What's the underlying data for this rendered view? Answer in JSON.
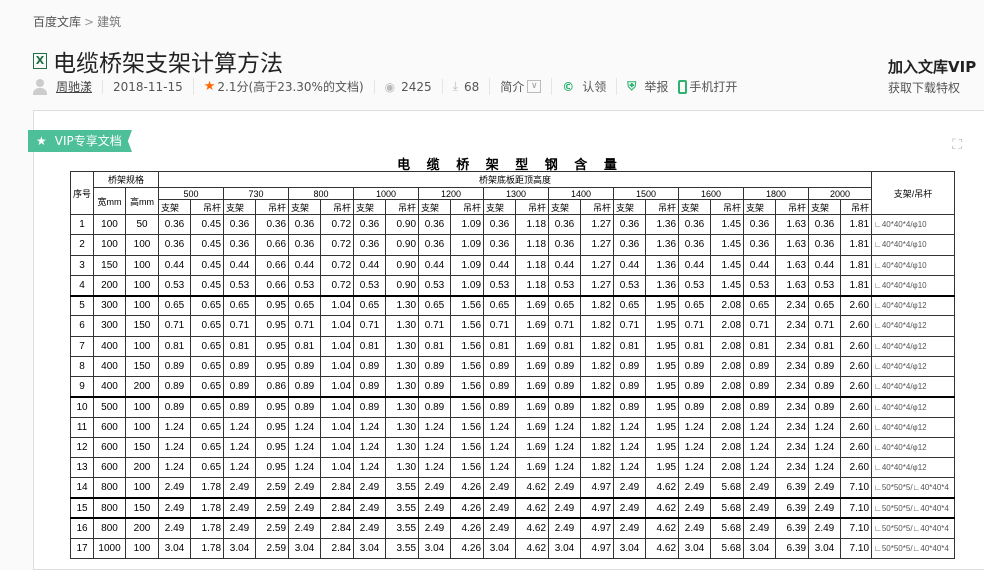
{
  "breadcrumb": {
    "home": "百度文库",
    "separator": ">",
    "current": "建筑"
  },
  "doc": {
    "title": "电缆桥架支架计算方法",
    "file_icon": "X"
  },
  "meta": {
    "author": "周驰漾",
    "date": "2018-11-15",
    "rating": "2.1分(高于23.30%的文档)",
    "views": "2425",
    "downloads": "68",
    "summary": "简介",
    "claim": "认领",
    "report": "举报",
    "mobile": "手机打开"
  },
  "vip": {
    "join": "加入文库VIP",
    "privilege": "获取下载特权",
    "badge": "VIP专享文档"
  },
  "colors": {
    "accent": "#4dbf99",
    "rating_star": "#ff6600",
    "icon_green": "#2db26f"
  },
  "table": {
    "title": "电 缆 桥 架 型 钢 含 量",
    "h_no": "序号",
    "h_spec": "桥架规格",
    "h_width": "宽mm",
    "h_height": "高mm",
    "h_distance": "桥架底板距顶高度",
    "h_last": "支架/吊杆",
    "sub": [
      "支架",
      "吊杆"
    ],
    "distances": [
      "500",
      "730",
      "800",
      "1000",
      "1200",
      "1300",
      "1400",
      "1500",
      "1600",
      "1800",
      "2000"
    ],
    "rows": [
      [
        "1",
        "100",
        "50",
        "0.36",
        "0.45",
        "0.36",
        "0.36",
        "0.36",
        "0.72",
        "0.36",
        "0.90",
        "0.36",
        "1.09",
        "0.36",
        "1.18",
        "0.36",
        "1.27",
        "0.36",
        "1.36",
        "0.36",
        "1.45",
        "0.36",
        "1.63",
        "0.36",
        "1.81",
        "∟40*40*4/φ10"
      ],
      [
        "2",
        "100",
        "100",
        "0.36",
        "0.45",
        "0.36",
        "0.66",
        "0.36",
        "0.72",
        "0.36",
        "0.90",
        "0.36",
        "1.09",
        "0.36",
        "1.18",
        "0.36",
        "1.27",
        "0.36",
        "1.36",
        "0.36",
        "1.45",
        "0.36",
        "1.63",
        "0.36",
        "1.81",
        "∟40*40*4/φ10"
      ],
      [
        "3",
        "150",
        "100",
        "0.44",
        "0.45",
        "0.44",
        "0.66",
        "0.44",
        "0.72",
        "0.44",
        "0.90",
        "0.44",
        "1.09",
        "0.44",
        "1.18",
        "0.44",
        "1.27",
        "0.44",
        "1.36",
        "0.44",
        "1.45",
        "0.44",
        "1.63",
        "0.44",
        "1.81",
        "∟40*40*4/φ10"
      ],
      [
        "4",
        "200",
        "100",
        "0.53",
        "0.45",
        "0.53",
        "0.66",
        "0.53",
        "0.72",
        "0.53",
        "0.90",
        "0.53",
        "1.09",
        "0.53",
        "1.18",
        "0.53",
        "1.27",
        "0.53",
        "1.36",
        "0.53",
        "1.45",
        "0.53",
        "1.63",
        "0.53",
        "1.81",
        "∟40*40*4/φ10"
      ],
      [
        "5",
        "300",
        "100",
        "0.65",
        "0.65",
        "0.65",
        "0.95",
        "0.65",
        "1.04",
        "0.65",
        "1.30",
        "0.65",
        "1.56",
        "0.65",
        "1.69",
        "0.65",
        "1.82",
        "0.65",
        "1.95",
        "0.65",
        "2.08",
        "0.65",
        "2.34",
        "0.65",
        "2.60",
        "∟40*40*4/φ12"
      ],
      [
        "6",
        "300",
        "150",
        "0.71",
        "0.65",
        "0.71",
        "0.95",
        "0.71",
        "1.04",
        "0.71",
        "1.30",
        "0.71",
        "1.56",
        "0.71",
        "1.69",
        "0.71",
        "1.82",
        "0.71",
        "1.95",
        "0.71",
        "2.08",
        "0.71",
        "2.34",
        "0.71",
        "2.60",
        "∟40*40*4/φ12"
      ],
      [
        "7",
        "400",
        "100",
        "0.81",
        "0.65",
        "0.81",
        "0.95",
        "0.81",
        "1.04",
        "0.81",
        "1.30",
        "0.81",
        "1.56",
        "0.81",
        "1.69",
        "0.81",
        "1.82",
        "0.81",
        "1.95",
        "0.81",
        "2.08",
        "0.81",
        "2.34",
        "0.81",
        "2.60",
        "∟40*40*4/φ12"
      ],
      [
        "8",
        "400",
        "150",
        "0.89",
        "0.65",
        "0.89",
        "0.95",
        "0.89",
        "1.04",
        "0.89",
        "1.30",
        "0.89",
        "1.56",
        "0.89",
        "1.69",
        "0.89",
        "1.82",
        "0.89",
        "1.95",
        "0.89",
        "2.08",
        "0.89",
        "2.34",
        "0.89",
        "2.60",
        "∟40*40*4/φ12"
      ],
      [
        "9",
        "400",
        "200",
        "0.89",
        "0.65",
        "0.89",
        "0.86",
        "0.89",
        "1.04",
        "0.89",
        "1.30",
        "0.89",
        "1.56",
        "0.89",
        "1.69",
        "0.89",
        "1.82",
        "0.89",
        "1.95",
        "0.89",
        "2.08",
        "0.89",
        "2.34",
        "0.89",
        "2.60",
        "∟40*40*4/φ12"
      ],
      [
        "10",
        "500",
        "100",
        "0.89",
        "0.65",
        "0.89",
        "0.95",
        "0.89",
        "1.04",
        "0.89",
        "1.30",
        "0.89",
        "1.56",
        "0.89",
        "1.69",
        "0.89",
        "1.82",
        "0.89",
        "1.95",
        "0.89",
        "2.08",
        "0.89",
        "2.34",
        "0.89",
        "2.60",
        "∟40*40*4/φ12"
      ],
      [
        "11",
        "600",
        "100",
        "1.24",
        "0.65",
        "1.24",
        "0.95",
        "1.24",
        "1.04",
        "1.24",
        "1.30",
        "1.24",
        "1.56",
        "1.24",
        "1.69",
        "1.24",
        "1.82",
        "1.24",
        "1.95",
        "1.24",
        "2.08",
        "1.24",
        "2.34",
        "1.24",
        "2.60",
        "∟40*40*4/φ12"
      ],
      [
        "12",
        "600",
        "150",
        "1.24",
        "0.65",
        "1.24",
        "0.95",
        "1.24",
        "1.04",
        "1.24",
        "1.30",
        "1.24",
        "1.56",
        "1.24",
        "1.69",
        "1.24",
        "1.82",
        "1.24",
        "1.95",
        "1.24",
        "2.08",
        "1.24",
        "2.34",
        "1.24",
        "2.60",
        "∟40*40*4/φ12"
      ],
      [
        "13",
        "600",
        "200",
        "1.24",
        "0.65",
        "1.24",
        "0.95",
        "1.24",
        "1.04",
        "1.24",
        "1.30",
        "1.24",
        "1.56",
        "1.24",
        "1.69",
        "1.24",
        "1.82",
        "1.24",
        "1.95",
        "1.24",
        "2.08",
        "1.24",
        "2.34",
        "1.24",
        "2.60",
        "∟40*40*4/φ12"
      ],
      [
        "14",
        "800",
        "100",
        "2.49",
        "1.78",
        "2.49",
        "2.59",
        "2.49",
        "2.84",
        "2.49",
        "3.55",
        "2.49",
        "4.26",
        "2.49",
        "4.62",
        "2.49",
        "4.97",
        "2.49",
        "4.62",
        "2.49",
        "5.68",
        "2.49",
        "6.39",
        "2.49",
        "7.10",
        "∟50*50*5/∟40*40*4"
      ],
      [
        "15",
        "800",
        "150",
        "2.49",
        "1.78",
        "2.49",
        "2.59",
        "2.49",
        "2.84",
        "2.49",
        "3.55",
        "2.49",
        "4.26",
        "2.49",
        "4.62",
        "2.49",
        "4.97",
        "2.49",
        "4.62",
        "2.49",
        "5.68",
        "2.49",
        "6.39",
        "2.49",
        "7.10",
        "∟50*50*5/∟40*40*4"
      ],
      [
        "16",
        "800",
        "200",
        "2.49",
        "1.78",
        "2.49",
        "2.59",
        "2.49",
        "2.84",
        "2.49",
        "3.55",
        "2.49",
        "4.26",
        "2.49",
        "4.62",
        "2.49",
        "4.97",
        "2.49",
        "4.62",
        "2.49",
        "5.68",
        "2.49",
        "6.39",
        "2.49",
        "7.10",
        "∟50*50*5/∟40*40*4"
      ],
      [
        "17",
        "1000",
        "100",
        "3.04",
        "1.78",
        "3.04",
        "2.59",
        "3.04",
        "2.84",
        "3.04",
        "3.55",
        "3.04",
        "4.26",
        "3.04",
        "4.62",
        "3.04",
        "4.97",
        "3.04",
        "4.62",
        "3.04",
        "5.68",
        "3.04",
        "6.39",
        "3.04",
        "7.10",
        "∟50*50*5/∟40*40*4"
      ]
    ]
  }
}
